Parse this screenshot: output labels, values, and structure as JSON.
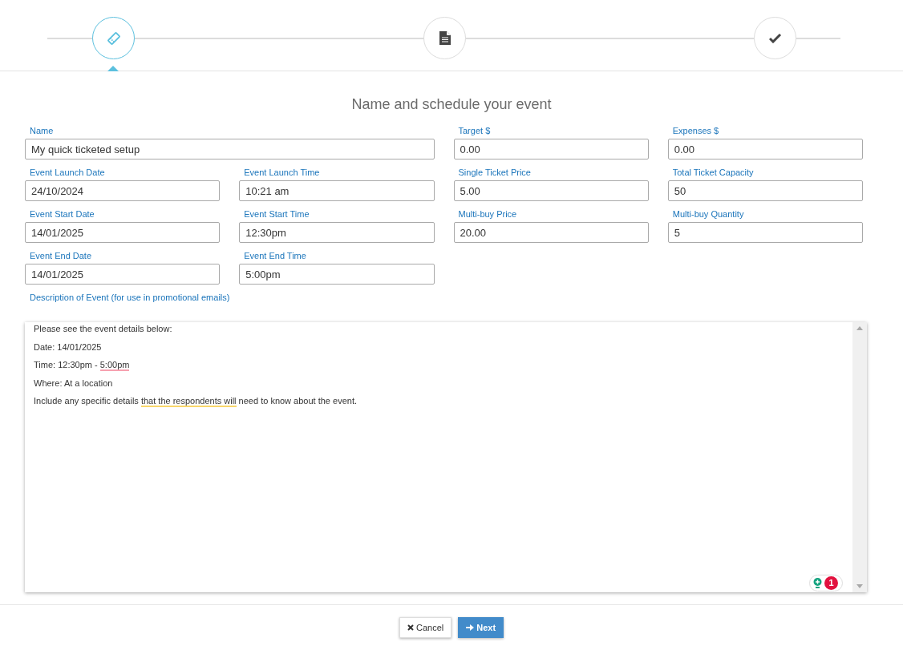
{
  "steps": [
    {
      "kind": "ticket",
      "selected": true
    },
    {
      "kind": "document",
      "selected": false
    },
    {
      "kind": "check",
      "selected": false
    }
  ],
  "heading": "Name and schedule your event",
  "fields": [
    {
      "label": "Name",
      "value": "My quick ticketed setup",
      "wide": true
    },
    {
      "label": "Target $",
      "value": "0.00",
      "wide": false
    },
    {
      "label": "Expenses $",
      "value": "0.00",
      "wide": false
    },
    {
      "label": "Event Launch Date",
      "value": "24/10/2024",
      "wide": false
    },
    {
      "label": "Event Launch Time",
      "value": "10:21 am",
      "wide": false
    },
    {
      "label": "Single Ticket Price",
      "value": "5.00",
      "wide": false
    },
    {
      "label": "Total Ticket Capacity",
      "value": "50",
      "wide": false
    },
    {
      "label": "Event Start Date",
      "value": "14/01/2025",
      "wide": false
    },
    {
      "label": "Event Start Time",
      "value": "12:30pm",
      "wide": false
    },
    {
      "label": "Multi-buy Price",
      "value": "20.00",
      "wide": false
    },
    {
      "label": "Multi-buy Quantity",
      "value": "5",
      "wide": false
    },
    {
      "label": "Event End Date",
      "value": "14/01/2025",
      "wide": false
    },
    {
      "label": "Event End Time",
      "value": "5:00pm",
      "wide": false
    }
  ],
  "description": {
    "label": "Description of Event (for use in promotional emails)",
    "lines": [
      [
        {
          "text": "Please see the event details below:",
          "kind": "plain"
        }
      ],
      [
        {
          "text": "Date: 14/01/2025",
          "kind": "plain"
        }
      ],
      [
        {
          "text": "Time: 12:30pm - ",
          "kind": "plain"
        },
        {
          "text": "5:00pm",
          "kind": "spelling"
        }
      ],
      [
        {
          "text": "Where: At a location",
          "kind": "plain"
        }
      ],
      [
        {
          "text": "Include any specific details ",
          "kind": "plain"
        },
        {
          "text": "that the respondents will",
          "kind": "grammar"
        },
        {
          "text": " need to know about the event.",
          "kind": "plain"
        }
      ]
    ],
    "issue_count": "1"
  },
  "buttons": [
    {
      "kind": "cancel",
      "label": "Cancel"
    },
    {
      "kind": "next",
      "label": "Next"
    }
  ]
}
